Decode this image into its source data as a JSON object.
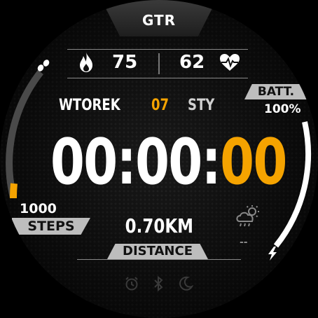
{
  "header": {
    "brand": "GTR"
  },
  "stats": {
    "calories": "75",
    "heart_rate": "62"
  },
  "date": {
    "weekday": "WTOREK",
    "day": "07",
    "month": "STY"
  },
  "battery": {
    "label": "BATT.",
    "value": "100%",
    "level_fraction": 1.0
  },
  "time": {
    "hh_mm": "00:00:",
    "seconds": "00"
  },
  "steps": {
    "value": "1000",
    "label": "STEPS",
    "progress_fraction": 0.1
  },
  "distance": {
    "value": "0.70KM",
    "label": "DISTANCE"
  },
  "weather": {
    "temperature": "--",
    "icon": "cloud-sun-rain-icon"
  },
  "status_icons": [
    "alarm-icon",
    "bluetooth-icon",
    "moon-icon"
  ],
  "colors": {
    "accent": "#f5a300",
    "text": "#ffffff",
    "tag_bg": "#bdbdbd",
    "arc_track": "#4a4a4a"
  }
}
